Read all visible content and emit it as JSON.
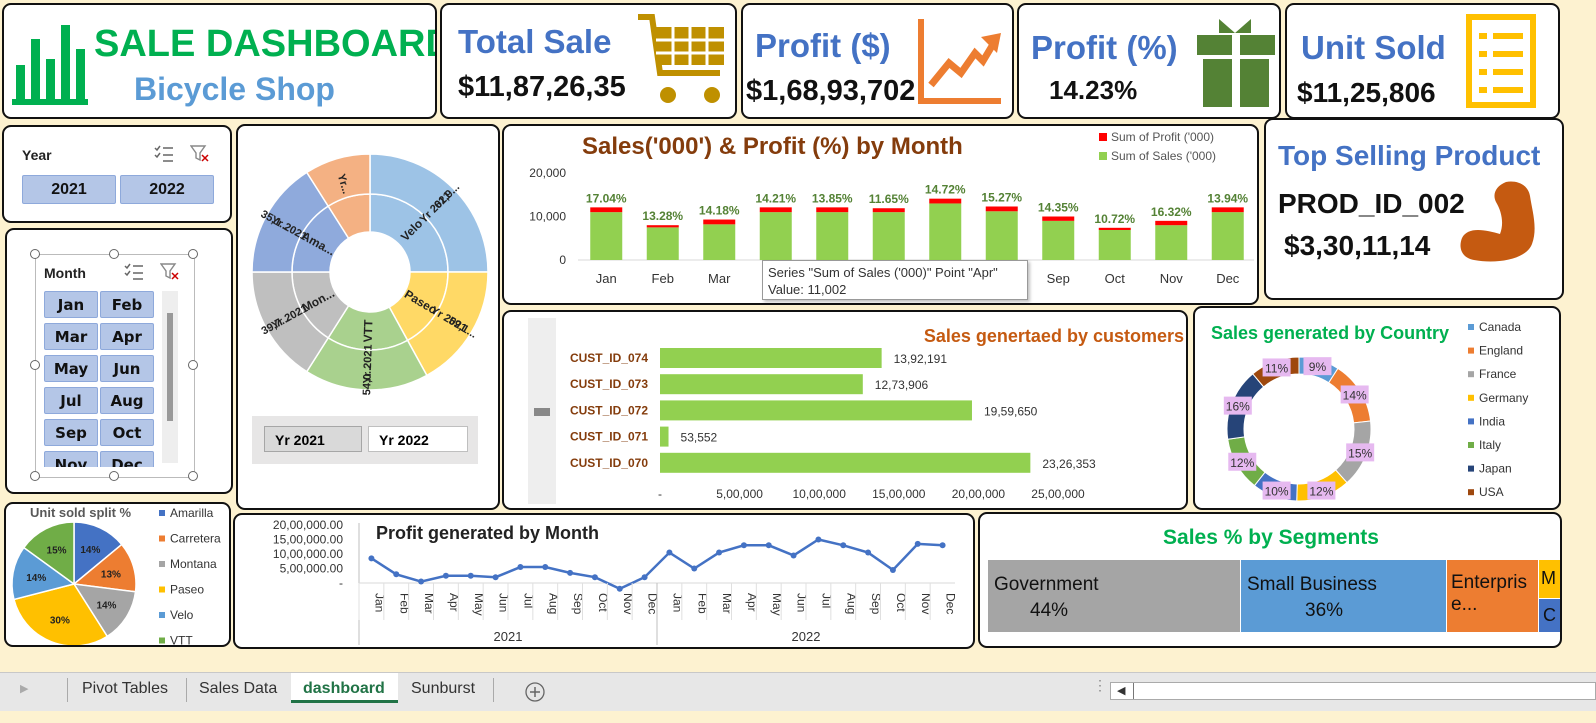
{
  "header": {
    "title": "SALE DASHBOARD",
    "subtitle": "Bicycle Shop"
  },
  "kpis": [
    {
      "title": "Total Sale",
      "value": "$11,87,26,35",
      "icon": "shopping-cart-icon",
      "color": "#bf9000"
    },
    {
      "title": "Profit ($)",
      "value": "$1,68,93,702",
      "icon": "trend-up-icon",
      "color": "#ed7d31"
    },
    {
      "title": "Profit (%)",
      "value": "14.23%",
      "icon": "gift-icon",
      "color": "#548235"
    },
    {
      "title": "Unit Sold",
      "value": "$11,25,806",
      "icon": "checklist-icon",
      "color": "#ffc000"
    }
  ],
  "year_slicer": {
    "title": "Year",
    "items": [
      "2021",
      "2022"
    ]
  },
  "month_slicer": {
    "title": "Month",
    "items": [
      "Jan",
      "Feb",
      "Mar",
      "Apr",
      "May",
      "Jun",
      "Jul",
      "Aug",
      "Sep",
      "Oct",
      "Nov",
      "Dec"
    ]
  },
  "sunburst": {
    "inner": [
      {
        "label": "Velo",
        "color": "#9dc3e6"
      },
      {
        "label": "Paseo",
        "color": "#ffd966"
      },
      {
        "label": "VTT",
        "color": "#a9d18e"
      },
      {
        "label": "Mon...",
        "color": "#bfbfbf"
      },
      {
        "label": "Ama...",
        "color": "#8faadc"
      },
      {
        "label": "",
        "color": "#f4b183"
      }
    ],
    "outer_year": [
      "Yr 2021",
      "Yr 2021",
      "Yr 2021",
      "Yr 2021",
      "Yr 2021",
      "Yr..."
    ],
    "outer_value": [
      "61,9...",
      "59,1...",
      "54,0...",
      "39,7...",
      "35,1...",
      ""
    ],
    "toggle": [
      "Yr 2021",
      "Yr 2022"
    ]
  },
  "chart_data": [
    {
      "type": "bar",
      "title": "Sales('000') & Profit (%) by Month",
      "categories": [
        "Jan",
        "Feb",
        "Mar",
        "Apr",
        "May",
        "Jun",
        "Jul",
        "Aug",
        "Sep",
        "Oct",
        "Nov",
        "Dec"
      ],
      "series": [
        {
          "name": "Sum of Sales ('000)",
          "values": [
            11000,
            7500,
            8200,
            11002,
            11000,
            11000,
            13000,
            11200,
            9000,
            6900,
            8000,
            11000
          ],
          "color": "#92d050"
        },
        {
          "name": "Sum of Profit ('000)",
          "values": [
            1100,
            500,
            1100,
            1100,
            1100,
            900,
            1100,
            1100,
            1000,
            500,
            1000,
            1100
          ],
          "color": "#ff0000"
        }
      ],
      "data_labels": [
        "17.04%",
        "13.28%",
        "14.18%",
        "14.21%",
        "13.85%",
        "11.65%",
        "14.72%",
        "15.27%",
        "14.35%",
        "10.72%",
        "16.32%",
        "13.94%"
      ],
      "ylim": [
        0,
        20000
      ],
      "yticks": [
        "20,000",
        "10,000",
        "0"
      ],
      "legend": "top-right",
      "tooltip": {
        "line1": "Series \"Sum of Sales ('000)\" Point \"Apr\"",
        "line2": "Value: 11,002"
      }
    },
    {
      "type": "bar",
      "orientation": "horizontal",
      "title": "Sales genertaed by customers",
      "categories": [
        "CUST_ID_074",
        "CUST_ID_073",
        "CUST_ID_072",
        "CUST_ID_071",
        "CUST_ID_070"
      ],
      "values": [
        1392191,
        1273906,
        1959650,
        53552,
        2326353
      ],
      "value_labels": [
        "13,92,191",
        "12,73,906",
        "19,59,650",
        "53,552",
        "23,26,353"
      ],
      "xlim": [
        0,
        2500000
      ],
      "xticks": [
        "-",
        "5,00,000",
        "10,00,000",
        "15,00,000",
        "20,00,000",
        "25,00,000"
      ],
      "color": "#92d050"
    },
    {
      "type": "pie",
      "variant": "doughnut",
      "title": "Sales generated by Country",
      "categories": [
        "Canada",
        "England",
        "France",
        "Germany",
        "India",
        "Italy",
        "Japan",
        "USA"
      ],
      "values": [
        9,
        14,
        15,
        12,
        10,
        12,
        16,
        11
      ],
      "labels": [
        "9%",
        "14%",
        "15%",
        "12%",
        "10%",
        "12%",
        "16%",
        "11%"
      ],
      "colors": [
        "#5b9bd5",
        "#ed7d31",
        "#a5a5a5",
        "#ffc000",
        "#4472c4",
        "#70ad47",
        "#264478",
        "#9e480e"
      ],
      "legend": "right"
    },
    {
      "type": "pie",
      "title": "Unit sold split  %",
      "categories": [
        "Amarilla",
        "Carretera",
        "Montana",
        "Paseo",
        "Velo",
        "VTT"
      ],
      "values": [
        14,
        13,
        14,
        30,
        14,
        15
      ],
      "labels": [
        "14%",
        "13%",
        "14%",
        "30%",
        "14%",
        "15%"
      ],
      "colors": [
        "#4472c4",
        "#ed7d31",
        "#a5a5a5",
        "#ffc000",
        "#5b9bd5",
        "#70ad47"
      ],
      "legend": "right"
    },
    {
      "type": "line",
      "title": "Profit generated by Month",
      "categories": [
        "Jan",
        "Feb",
        "Mar",
        "Apr",
        "May",
        "Jun",
        "Jul",
        "Aug",
        "Sep",
        "Oct",
        "Nov",
        "Dec",
        "Jan",
        "Feb",
        "Mar",
        "Apr",
        "May",
        "Jun",
        "Jul",
        "Aug",
        "Sep",
        "Oct",
        "Nov",
        "Dec"
      ],
      "groups": [
        "2021",
        "2022"
      ],
      "values": [
        850000,
        300000,
        50000,
        250000,
        250000,
        200000,
        550000,
        550000,
        350000,
        200000,
        -200000,
        200000,
        1050000,
        500000,
        1050000,
        1300000,
        1300000,
        950000,
        1500000,
        1300000,
        1050000,
        450000,
        1350000,
        1300000
      ],
      "ylim": [
        0,
        2000000
      ],
      "yticks": [
        "20,00,000.00",
        "15,00,000.00",
        "10,00,000.00",
        "5,00,000.00",
        "-"
      ],
      "color": "#4472c4"
    },
    {
      "type": "heatmap",
      "variant": "treemap",
      "title": "Sales % by Segments",
      "categories": [
        "Government",
        "Small Business",
        "Enterpris e...",
        "M",
        "C"
      ],
      "values": [
        44,
        36,
        0,
        0,
        0
      ],
      "labels": [
        "44%",
        "36%",
        "",
        "",
        ""
      ],
      "colors": [
        "#a5a5a5",
        "#5b9bd5",
        "#ed7d31",
        "#ffc000",
        "#4472c4"
      ]
    }
  ],
  "top_product": {
    "title": "Top Selling Product",
    "product": "PROD_ID_002",
    "value": "$3,30,11,14",
    "icon": "flexed-arm-icon"
  },
  "sheet_tabs": [
    "Pivot Tables",
    "Sales Data",
    "dashboard",
    "Sunburst"
  ],
  "active_tab": "dashboard"
}
